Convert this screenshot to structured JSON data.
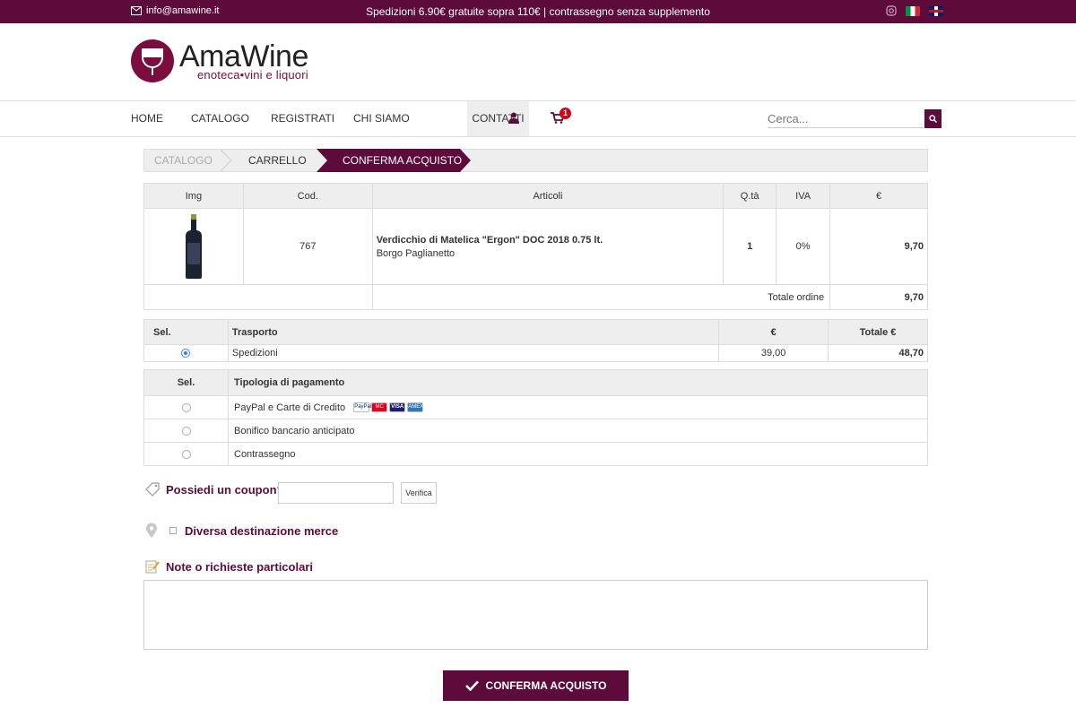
{
  "topbar": {
    "email": "info@amawine.it",
    "promo": "Spedizioni 6.90€ gratuite sopra 110€ | contrassegno senza supplemento"
  },
  "logo": {
    "title": "AmaWine",
    "subtitle": "enoteca•vini e liquori"
  },
  "nav": {
    "items": [
      "HOME",
      "CATALOGO",
      "REGISTRATI",
      "CHI SIAMO",
      "CONTATTI"
    ],
    "cart_count": "1",
    "search_placeholder": "Cerca..."
  },
  "steps": [
    "CATALOGO",
    "CARRELLO",
    "CONFERMA ACQUISTO"
  ],
  "items_table": {
    "headers": [
      "Img",
      "Cod.",
      "Articoli",
      "Q.tà",
      "IVA",
      "€"
    ],
    "rows": [
      {
        "code": "767",
        "name": "Verdicchio di Matelica \"Ergon\" DOC 2018 0.75 lt.",
        "producer": "Borgo Paglianetto",
        "qty": "1",
        "vat": "0%",
        "price": "9,70"
      }
    ],
    "total_label": "Totale ordine",
    "total_value": "9,70"
  },
  "shipping_table": {
    "headers": [
      "Sel.",
      "Trasporto",
      "€",
      "Totale €"
    ],
    "row": {
      "name": "Spedizioni",
      "price": "39,00",
      "total": "48,70",
      "selected": true
    }
  },
  "payment_table": {
    "headers": [
      "Sel.",
      "Tipologia di pagamento"
    ],
    "options": [
      "PayPal e Carte di Credito",
      "Bonifico bancario anticipato",
      "Contrassegno"
    ],
    "card_labels": [
      "PayPal",
      "MC",
      "VISA",
      "AMEX"
    ]
  },
  "coupon": {
    "label": "Possiedi un coupon?",
    "verify": "Verifica",
    "value": ""
  },
  "destination": {
    "label": "Diversa destinazione merce"
  },
  "notes": {
    "label": "Note o richieste particolari",
    "value": ""
  },
  "confirm": {
    "label": "CONFERMA ACQUISTO"
  },
  "colors": {
    "brand": "#5c0b3a",
    "badge": "#d0021b",
    "radio": "#3b82f6"
  },
  "icons": [
    "envelope-icon",
    "instagram-icon",
    "italy-flag-icon",
    "uk-flag-icon",
    "user-icon",
    "cart-icon",
    "search-icon",
    "tag-icon",
    "map-pin-icon",
    "note-icon",
    "check-icon"
  ]
}
